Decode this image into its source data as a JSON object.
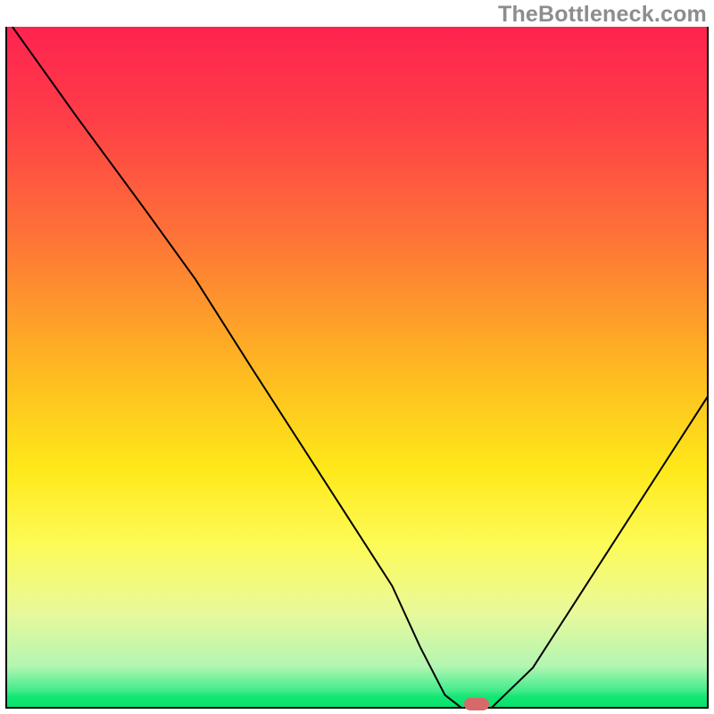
{
  "watermark": "TheBottleneck.com",
  "chart_data": {
    "type": "line",
    "title": "",
    "xlabel": "",
    "ylabel": "",
    "xlim": [
      0,
      100
    ],
    "ylim": [
      0,
      100
    ],
    "grid": false,
    "legend": false,
    "series": [
      {
        "name": "curve",
        "color": "#000000",
        "x": [
          1,
          10,
          20,
          27,
          35,
          45,
          55,
          59,
          62.5,
          65,
          69,
          75,
          85,
          95,
          100
        ],
        "y": [
          100,
          87,
          73,
          63,
          50,
          34,
          18,
          9,
          2,
          0,
          0,
          6,
          22,
          38,
          46
        ]
      }
    ],
    "marker": {
      "x": 67,
      "y": 0.7,
      "color": "#d66a6a",
      "shape": "pill"
    },
    "background_gradient": {
      "orientation": "vertical",
      "stops": [
        {
          "pos": 0.0,
          "color": "#fe2350"
        },
        {
          "pos": 0.14,
          "color": "#fe3f47"
        },
        {
          "pos": 0.3,
          "color": "#fe7038"
        },
        {
          "pos": 0.52,
          "color": "#febe20"
        },
        {
          "pos": 0.65,
          "color": "#fee81a"
        },
        {
          "pos": 0.76,
          "color": "#fdfb57"
        },
        {
          "pos": 0.86,
          "color": "#e9f99a"
        },
        {
          "pos": 0.94,
          "color": "#b3f6b2"
        },
        {
          "pos": 0.975,
          "color": "#46ec8c"
        },
        {
          "pos": 0.985,
          "color": "#14e674"
        },
        {
          "pos": 1.0,
          "color": "#07e36c"
        }
      ]
    }
  }
}
